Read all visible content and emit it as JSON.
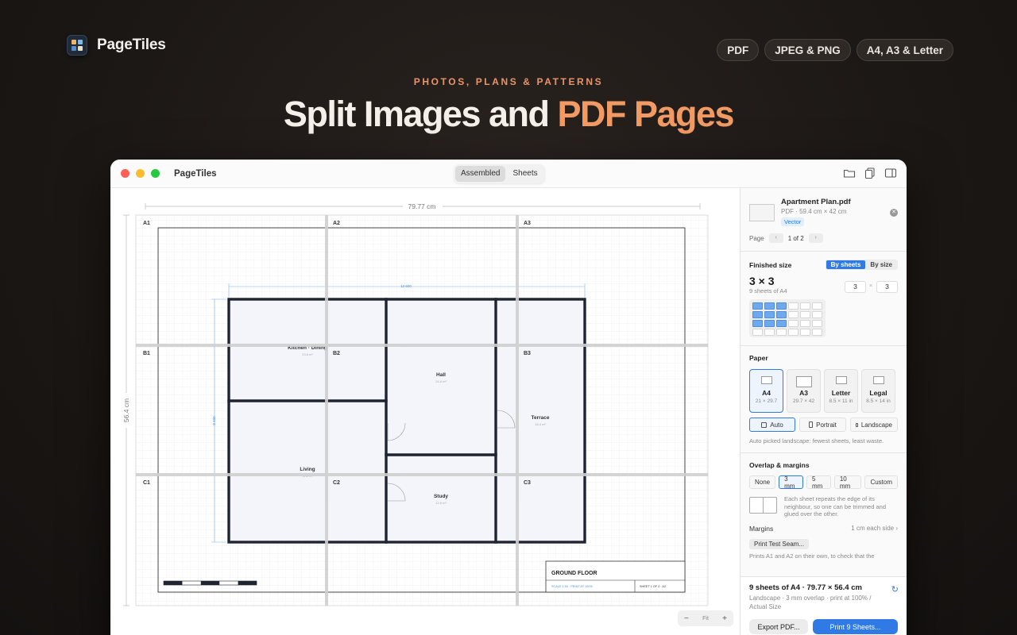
{
  "brand": {
    "name": "PageTiles"
  },
  "pills": [
    "PDF",
    "JPEG & PNG",
    "A4, A3 & Letter"
  ],
  "hero": {
    "eyebrow": "PHOTOS, PLANS & PATTERNS",
    "title_plain": "Split Images and ",
    "title_accent": "PDF Pages"
  },
  "window": {
    "title": "PageTiles",
    "view_tabs": [
      "Assembled",
      "Sheets"
    ],
    "active_tab": "Assembled",
    "toolbar_icons": [
      "open-folder-icon",
      "copy-pages-icon",
      "sidebar-toggle-icon"
    ]
  },
  "canvas": {
    "width_label": "79.77 cm",
    "height_label": "56.4 cm",
    "tiles": [
      "A1",
      "A2",
      "A3",
      "B1",
      "B2",
      "B3",
      "C1",
      "C2",
      "C3"
    ],
    "plan_dim_top": "12 600",
    "plan_dim_left": "8 400",
    "rooms": [
      {
        "name": "Kitchen · Dining",
        "area": "23.6 m²"
      },
      {
        "name": "Hall",
        "area": "24.8 m²"
      },
      {
        "name": "Terrace",
        "area": "18.4 m²"
      },
      {
        "name": "Living",
        "area": "31.2 m²"
      },
      {
        "name": "Study",
        "area": "12.6 m²"
      }
    ],
    "title_block": {
      "title": "GROUND FLOOR",
      "scale": "SCALE 1:50 · PRINT AT 100%",
      "sheet": "SHEET 1 OF 2 · A2"
    },
    "zoom": {
      "minus": "−",
      "fit": "Fit",
      "plus": "+"
    }
  },
  "sidebar": {
    "file": {
      "name": "Apartment Plan.pdf",
      "meta": "PDF · 59.4 cm × 42 cm",
      "badge": "Vector",
      "page_label": "Page",
      "page_value": "1 of 2"
    },
    "finished_size": {
      "label": "Finished size",
      "modes": [
        "By sheets",
        "By size"
      ],
      "active_mode": "By sheets",
      "big": "3 × 3",
      "sub": "9 sheets of A4",
      "cols": "3",
      "rows": "3",
      "times": "×"
    },
    "paper": {
      "label": "Paper",
      "options": [
        {
          "name": "A4",
          "dims": "21 × 29.7",
          "selected": true
        },
        {
          "name": "A3",
          "dims": "29.7 × 42",
          "selected": false
        },
        {
          "name": "Letter",
          "dims": "8.5 × 11 in",
          "selected": false
        },
        {
          "name": "Legal",
          "dims": "8.5 × 14 in",
          "selected": false
        }
      ],
      "orientations": [
        "Auto",
        "Portrait",
        "Landscape"
      ],
      "active_orientation": "Auto",
      "hint": "Auto picked landscape: fewest sheets, least waste."
    },
    "overlap": {
      "label": "Overlap & margins",
      "options": [
        "None",
        "3 mm",
        "5 mm",
        "10 mm",
        "Custom"
      ],
      "active": "3 mm",
      "note": "Each sheet repeats the edge of its neighbour, so one can be trimmed and glued over the other.",
      "margins_label": "Margins",
      "margins_value": "1 cm each side",
      "seam_button": "Print Test Seam...",
      "seam_hint": "Prints A1 and A2 on their own, to check that the"
    },
    "footer": {
      "title": "9 sheets of A4 · 79.77 × 56.4 cm",
      "sub": "Landscape · 3 mm overlap · print at 100% / Actual Size",
      "export": "Export PDF...",
      "print": "Print 9 Sheets..."
    }
  },
  "colors": {
    "accent_orange": "#f29a63",
    "primary_blue": "#2f7ae5",
    "wall": "#1e2430",
    "dimension_blue": "#4a90e2"
  }
}
